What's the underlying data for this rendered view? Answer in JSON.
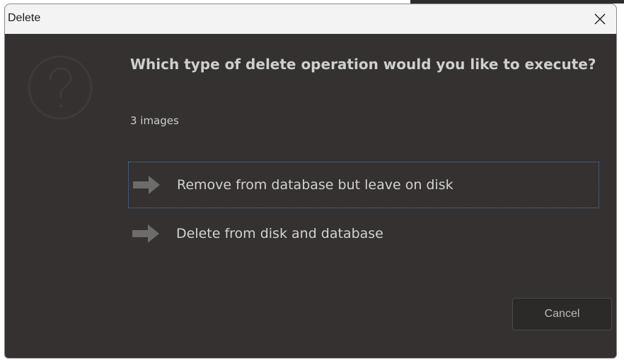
{
  "window": {
    "title": "Delete"
  },
  "dialog": {
    "heading": "Which type of delete operation would you like to execute?",
    "subtext": "3 images",
    "options": [
      {
        "label": "Remove from database but leave on disk",
        "icon": "arrow-right-icon",
        "focused": true
      },
      {
        "label": "Delete from disk and database",
        "icon": "arrow-right-icon",
        "focused": false
      }
    ],
    "cancel_label": "Cancel"
  },
  "colors": {
    "background": "#343130",
    "titlebar": "#f3f3f3",
    "text": "#d2d2d2",
    "icon": "#6e6c6a",
    "focus_border": "#4a7fb8"
  }
}
